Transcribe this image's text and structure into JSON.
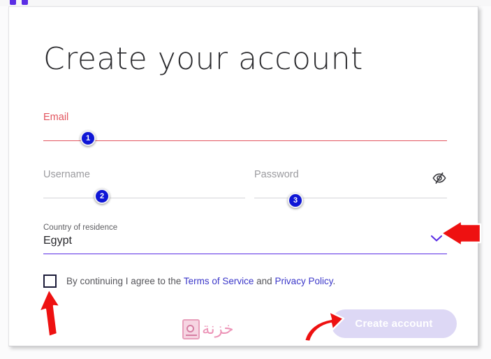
{
  "page": {
    "heading": "Create your account"
  },
  "fields": {
    "email": {
      "label": "Email",
      "value": "",
      "state": "error",
      "badge": "1"
    },
    "username": {
      "placeholder": "Username",
      "value": "",
      "badge": "2"
    },
    "password": {
      "placeholder": "Password",
      "value": "",
      "badge": "3",
      "toggle_icon": "eye-slash-icon"
    },
    "country": {
      "label": "Country of residence",
      "value": "Egypt",
      "chevron_icon": "chevron-down-icon"
    }
  },
  "terms": {
    "checked": false,
    "prefix": "By continuing I agree to the ",
    "terms_link": "Terms of Service",
    "conjunction": " and ",
    "privacy_link": "Privacy Policy",
    "suffix": "."
  },
  "submit": {
    "label": "Create account",
    "enabled": false
  },
  "watermark": {
    "text": "خزنة",
    "icon": "vault-icon"
  },
  "annotations": {
    "arrows": [
      {
        "name": "arrow-pointing-country-dropdown",
        "direction": "left"
      },
      {
        "name": "arrow-pointing-terms-checkbox",
        "direction": "up"
      },
      {
        "name": "arrow-pointing-create-account-button",
        "direction": "up-right"
      }
    ]
  },
  "colors": {
    "error": "#e2555f",
    "accent": "#5b2ee5",
    "link": "#3b37c9",
    "badge": "#0f16d6",
    "button_disabled": "#ddd8f5",
    "watermark": "#eb8fb4",
    "annotation": "#ee1111"
  }
}
